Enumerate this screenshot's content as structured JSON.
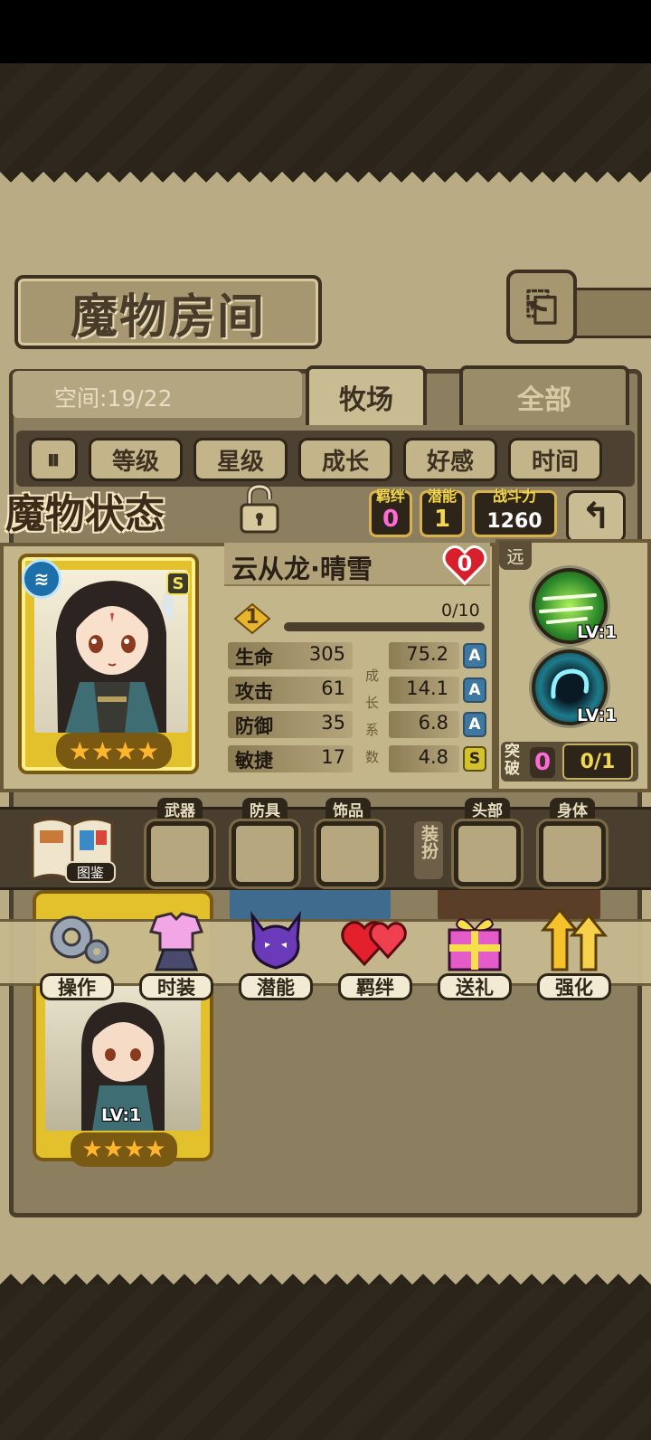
{
  "screen_title": "魔物房间",
  "space": {
    "label": "空间:19/22"
  },
  "tabs": [
    {
      "label": "牧场",
      "active": true
    },
    {
      "label": "全部",
      "active": false
    }
  ],
  "filters": [
    "等级",
    "星级",
    "成长",
    "好感",
    "时间"
  ],
  "status_section_title": "魔物状态",
  "header_stats": {
    "bond": {
      "label": "羁绊",
      "value": "0"
    },
    "potential": {
      "label": "潜能",
      "value": "1"
    },
    "power": {
      "label": "战斗力",
      "value": "1260"
    }
  },
  "monster": {
    "name": "云从龙·晴雪",
    "affection": "0",
    "element_icon": "water-element-icon",
    "rank": "S",
    "stars": 4,
    "level": "1",
    "exp": "0/10",
    "exp_fraction": 0,
    "attributes": [
      {
        "name": "生命",
        "value": "305",
        "growth": "75.2",
        "grade": "A"
      },
      {
        "name": "攻击",
        "value": "61",
        "growth": "14.1",
        "grade": "A"
      },
      {
        "name": "防御",
        "value": "35",
        "growth": "6.8",
        "grade": "A"
      },
      {
        "name": "敏捷",
        "value": "17",
        "growth": "4.8",
        "grade": "S"
      }
    ],
    "growth_label": [
      "成",
      "长",
      "系",
      "数"
    ]
  },
  "skills": {
    "range_tag": "远",
    "items": [
      {
        "name": "wind-slash-skill-icon",
        "level": "LV:1"
      },
      {
        "name": "vortex-skill-icon",
        "level": "LV:1"
      }
    ],
    "breakthrough": {
      "label": "突破",
      "count": "0",
      "progress": "0/1"
    }
  },
  "codex": {
    "label": "图鉴"
  },
  "equipment": {
    "slots": [
      {
        "label": "武器"
      },
      {
        "label": "防具"
      },
      {
        "label": "饰品"
      }
    ],
    "dress_label": "装扮",
    "cosmetic_slots": [
      {
        "label": "头部"
      },
      {
        "label": "身体"
      }
    ]
  },
  "actions": [
    {
      "label": "操作",
      "icon": "gear-icon"
    },
    {
      "label": "时装",
      "icon": "outfit-icon"
    },
    {
      "label": "潜能",
      "icon": "demon-icon"
    },
    {
      "label": "羁绊",
      "icon": "hearts-icon"
    },
    {
      "label": "送礼",
      "icon": "gift-icon"
    },
    {
      "label": "强化",
      "icon": "upgrade-arrows-icon"
    }
  ],
  "card": {
    "level": "LV:1",
    "stars": 4
  },
  "colors": {
    "parchment": "#b9ab84",
    "dark_wood": "#3d3222",
    "gold": "#e3c12c",
    "pink_count": "#ff69d8"
  }
}
